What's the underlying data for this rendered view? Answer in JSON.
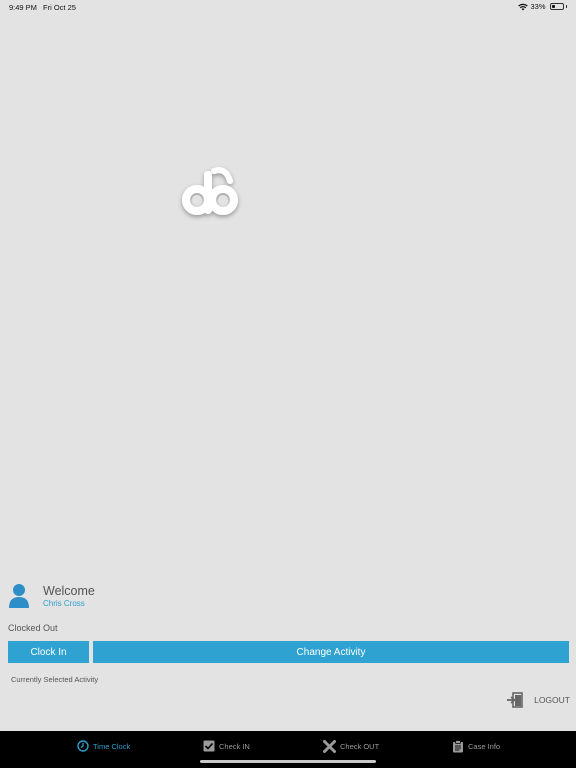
{
  "status_bar": {
    "time": "9:49 PM",
    "date": "Fri Oct 25",
    "battery_percent": "33%",
    "battery_level": 0.33
  },
  "welcome": {
    "title": "Welcome",
    "user_name": "Chris Cross"
  },
  "clock_status": "Clocked Out",
  "buttons": {
    "clock_in": "Clock In",
    "change_activity": "Change Activity"
  },
  "current_activity_label": "Currently Selected Activity",
  "logout_label": "LOGOUT",
  "tabs": [
    {
      "label": "Time Clock",
      "icon": "clock-icon",
      "active": true
    },
    {
      "label": "Check IN",
      "icon": "checkbox-icon",
      "active": false
    },
    {
      "label": "Check OUT",
      "icon": "x-icon",
      "active": false
    },
    {
      "label": "Case Info",
      "icon": "clipboard-icon",
      "active": false
    }
  ],
  "colors": {
    "accent": "#2ea2d1",
    "background": "#e3e3e3",
    "tab_bar": "#000000",
    "tab_inactive": "#9a9a9a"
  }
}
